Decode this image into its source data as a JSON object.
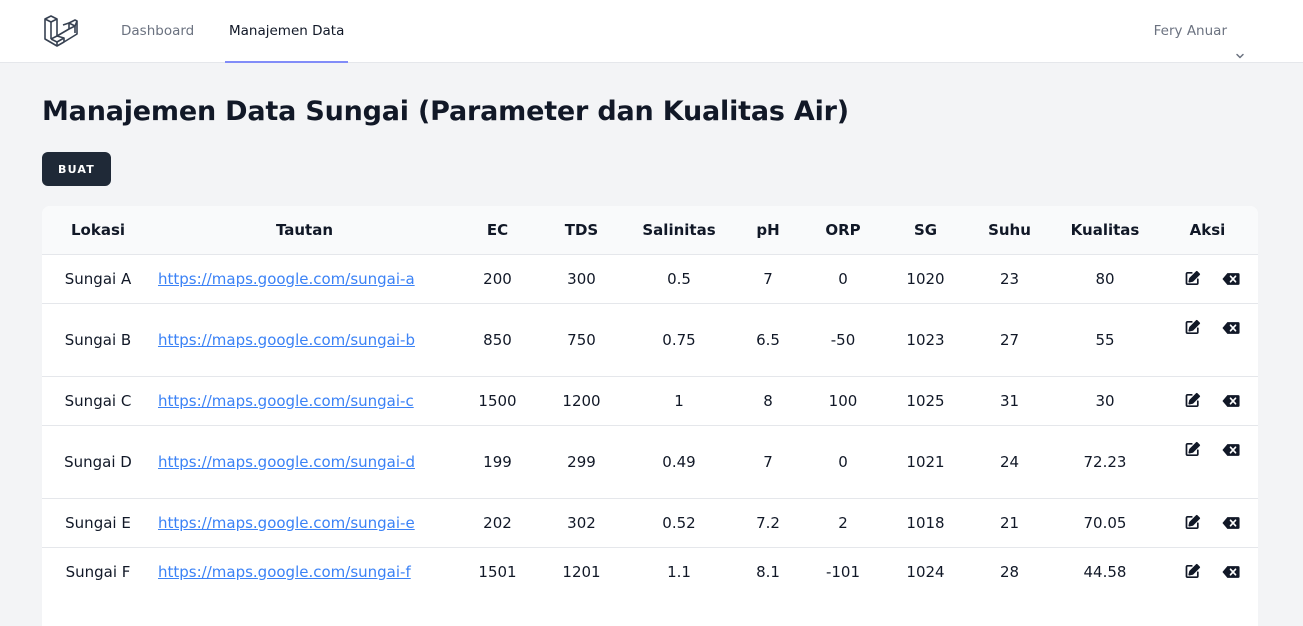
{
  "nav": {
    "links": [
      {
        "label": "Dashboard"
      },
      {
        "label": "Manajemen Data"
      }
    ],
    "user_name": "Fery Anuar",
    "active_color": "#818cf8"
  },
  "page": {
    "title": "Manajemen Data Sungai (Parameter dan Kualitas Air)",
    "create_button": "BUAT"
  },
  "table": {
    "headers": [
      "Lokasi",
      "Tautan",
      "EC",
      "TDS",
      "Salinitas",
      "pH",
      "ORP",
      "SG",
      "Suhu",
      "Kualitas",
      "Aksi"
    ],
    "rows": [
      {
        "lokasi": "Sungai A",
        "tautan": "https://maps.google.com/sungai-a",
        "ec": "200",
        "tds": "300",
        "salinitas": "0.5",
        "ph": "7",
        "orp": "0",
        "sg": "1020",
        "suhu": "23",
        "kualitas": "80"
      },
      {
        "lokasi": "Sungai B",
        "tautan": "https://maps.google.com/sungai-b",
        "ec": "850",
        "tds": "750",
        "salinitas": "0.75",
        "ph": "6.5",
        "orp": "-50",
        "sg": "1023",
        "suhu": "27",
        "kualitas": "55"
      },
      {
        "lokasi": "Sungai C",
        "tautan": "https://maps.google.com/sungai-c",
        "ec": "1500",
        "tds": "1200",
        "salinitas": "1",
        "ph": "8",
        "orp": "100",
        "sg": "1025",
        "suhu": "31",
        "kualitas": "30"
      },
      {
        "lokasi": "Sungai D",
        "tautan": "https://maps.google.com/sungai-d",
        "ec": "199",
        "tds": "299",
        "salinitas": "0.49",
        "ph": "7",
        "orp": "0",
        "sg": "1021",
        "suhu": "24",
        "kualitas": "72.23"
      },
      {
        "lokasi": "Sungai E",
        "tautan": "https://maps.google.com/sungai-e",
        "ec": "202",
        "tds": "302",
        "salinitas": "0.52",
        "ph": "7.2",
        "orp": "2",
        "sg": "1018",
        "suhu": "21",
        "kualitas": "70.05"
      },
      {
        "lokasi": "Sungai F",
        "tautan": "https://maps.google.com/sungai-f",
        "ec": "1501",
        "tds": "1201",
        "salinitas": "1.1",
        "ph": "8.1",
        "orp": "-101",
        "sg": "1024",
        "suhu": "28",
        "kualitas": "44.58"
      }
    ]
  },
  "icons": {
    "logo": "laravel-logo-icon",
    "user_chevron": "chevron-down-icon",
    "edit": "edit-icon",
    "delete": "backspace-delete-icon"
  }
}
